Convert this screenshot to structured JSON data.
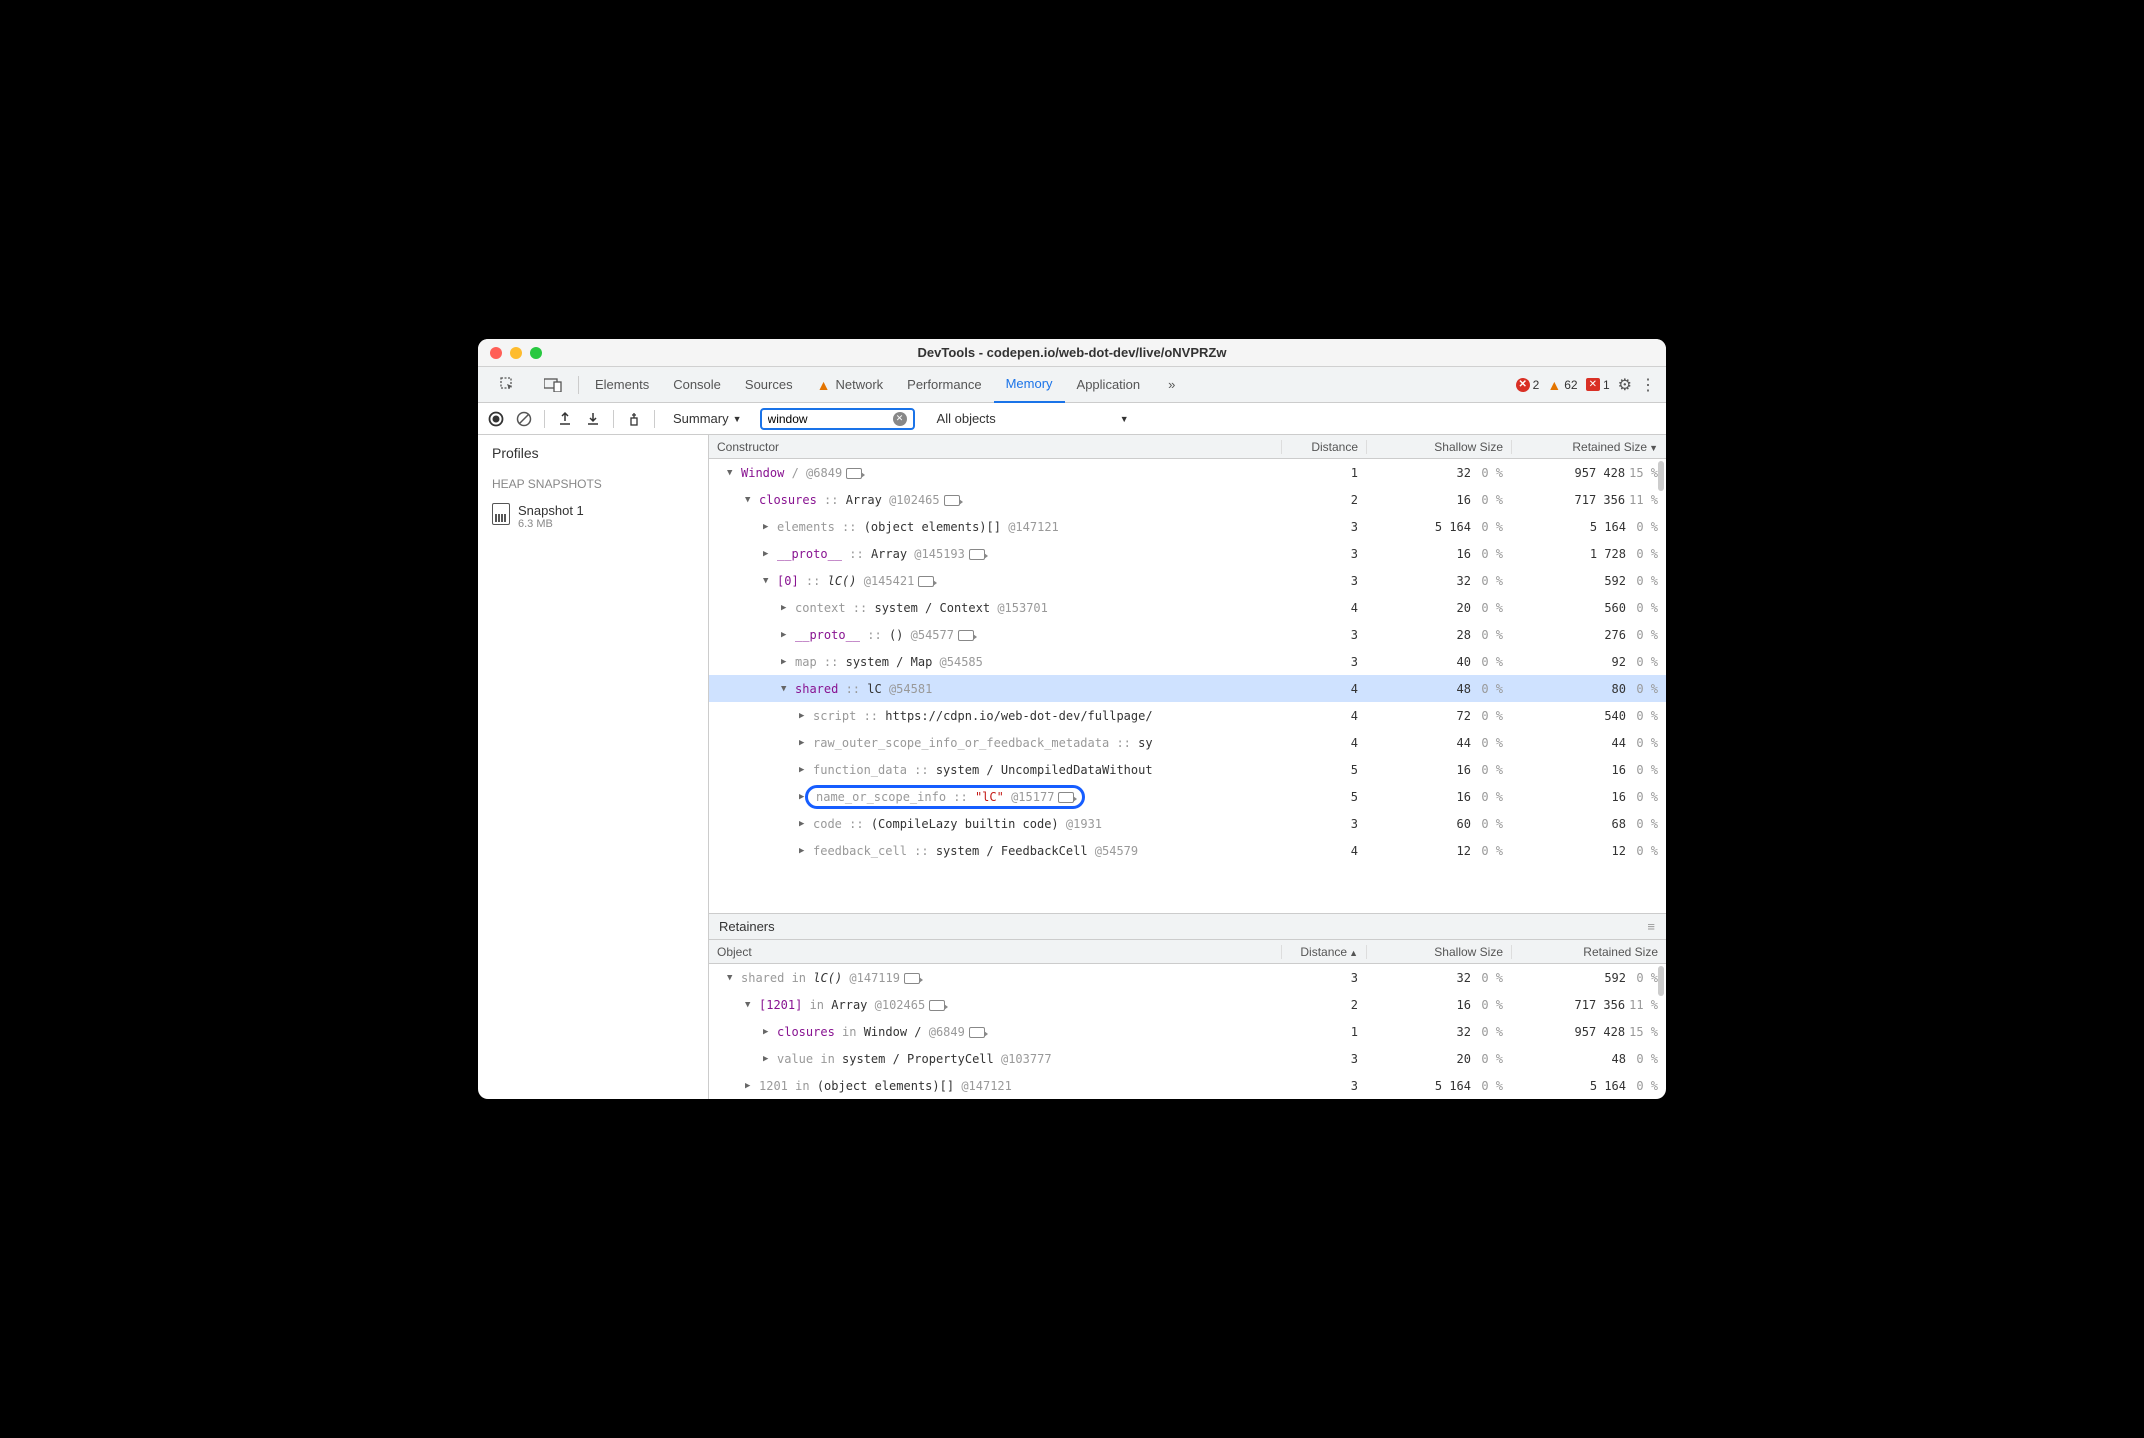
{
  "title": "DevTools - codepen.io/web-dot-dev/live/oNVPRZw",
  "tabs": [
    "Elements",
    "Console",
    "Sources",
    "Network",
    "Performance",
    "Memory",
    "Application"
  ],
  "active_tab": "Memory",
  "warn_tab": "Network",
  "overflow": "»",
  "errors": {
    "error": "2",
    "warn": "62",
    "blocked": "1"
  },
  "toolbar": {
    "view": "Summary",
    "filter_value": "window",
    "scope": "All objects"
  },
  "sidebar": {
    "heading": "Profiles",
    "section": "HEAP SNAPSHOTS",
    "snapshot": {
      "name": "Snapshot 1",
      "size": "6.3 MB"
    }
  },
  "columns": {
    "c": "Constructor",
    "d": "Distance",
    "s": "Shallow Size",
    "r": "Retained Size"
  },
  "retainers_columns": {
    "c": "Object",
    "d": "Distance",
    "s": "Shallow Size",
    "r": "Retained Size"
  },
  "retainers_label": "Retainers",
  "rows": [
    {
      "i": 0,
      "a": "▼",
      "pre": "",
      "prop": "Window",
      "mid": " /   ",
      "id": "@6849",
      "link": 1,
      "d": "1",
      "sv": "32",
      "sp": "0 %",
      "rv": "957 428",
      "rp": "15 %"
    },
    {
      "i": 1,
      "a": "▼",
      "prop": "closures",
      "sep": " :: ",
      "sys": "Array ",
      "id": "@102465",
      "link": 1,
      "d": "2",
      "sv": "16",
      "sp": "0 %",
      "rv": "717 356",
      "rp": "11 %"
    },
    {
      "i": 2,
      "a": "▶",
      "dim": "elements",
      "sep": " :: ",
      "sys": "(object elements)[] ",
      "id": "@147121",
      "d": "3",
      "sv": "5 164",
      "sp": "0 %",
      "rv": "5 164",
      "rp": "0 %"
    },
    {
      "i": 2,
      "a": "▶",
      "prop": "__proto__",
      "sep": " :: ",
      "sys": "Array ",
      "id": "@145193",
      "link": 1,
      "d": "3",
      "sv": "16",
      "sp": "0 %",
      "rv": "1 728",
      "rp": "0 %"
    },
    {
      "i": 2,
      "a": "▼",
      "prop": "[0]",
      "sep": " :: ",
      "ital": "lC()",
      "id": " @145421",
      "link": 1,
      "d": "3",
      "sv": "32",
      "sp": "0 %",
      "rv": "592",
      "rp": "0 %"
    },
    {
      "i": 3,
      "a": "▶",
      "dim": "context",
      "sep": " :: ",
      "sys": "system / Context ",
      "id": "@153701",
      "d": "4",
      "sv": "20",
      "sp": "0 %",
      "rv": "560",
      "rp": "0 %"
    },
    {
      "i": 3,
      "a": "▶",
      "prop": "__proto__",
      "sep": " :: ",
      "sys": "() ",
      "id": "@54577",
      "link": 1,
      "d": "3",
      "sv": "28",
      "sp": "0 %",
      "rv": "276",
      "rp": "0 %"
    },
    {
      "i": 3,
      "a": "▶",
      "dim": "map",
      "sep": " :: ",
      "sys": "system / Map ",
      "id": "@54585",
      "d": "3",
      "sv": "40",
      "sp": "0 %",
      "rv": "92",
      "rp": "0 %"
    },
    {
      "i": 3,
      "a": "▼",
      "prop": "shared",
      "sep": " :: ",
      "sys": "lC ",
      "id": "@54581",
      "d": "4",
      "sv": "48",
      "sp": "0 %",
      "rv": "80",
      "rp": "0 %",
      "sel": 1
    },
    {
      "i": 4,
      "a": "▶",
      "dim": "script",
      "sep": " :: ",
      "sys": "https://cdpn.io/web-dot-dev/fullpage/",
      "d": "4",
      "sv": "72",
      "sp": "0 %",
      "rv": "540",
      "rp": "0 %"
    },
    {
      "i": 4,
      "a": "▶",
      "dim": "raw_outer_scope_info_or_feedback_metadata",
      "sep": " :: ",
      "sys": "sy",
      "d": "4",
      "sv": "44",
      "sp": "0 %",
      "rv": "44",
      "rp": "0 %"
    },
    {
      "i": 4,
      "a": "▶",
      "dim": "function_data",
      "sep": " :: ",
      "sys": "system / UncompiledDataWithout",
      "d": "5",
      "sv": "16",
      "sp": "0 %",
      "rv": "16",
      "rp": "0 %"
    },
    {
      "i": 4,
      "a": "▶",
      "dim": "name_or_scope_info",
      "sep": " :: ",
      "str": "\"lC\"",
      "id": " @15177",
      "link": 1,
      "d": "5",
      "sv": "16",
      "sp": "0 %",
      "rv": "16",
      "rp": "0 %",
      "circ": 1
    },
    {
      "i": 4,
      "a": "▶",
      "dim": "code",
      "sep": " :: ",
      "sys": "(CompileLazy builtin code) ",
      "id": "@1931",
      "d": "3",
      "sv": "60",
      "sp": "0 %",
      "rv": "68",
      "rp": "0 %"
    },
    {
      "i": 4,
      "a": "▶",
      "dim": "feedback_cell",
      "sep": " :: ",
      "sys": "system / FeedbackCell ",
      "id": "@54579",
      "d": "4",
      "sv": "12",
      "sp": "0 %",
      "rv": "12",
      "rp": "0 %"
    }
  ],
  "retain_rows": [
    {
      "i": 0,
      "a": "▼",
      "dim": "shared",
      "mid": " in ",
      "ital": "lC()",
      "id": " @147119",
      "link": 1,
      "d": "3",
      "sv": "32",
      "sp": "0 %",
      "rv": "592",
      "rp": "0 %"
    },
    {
      "i": 1,
      "a": "▼",
      "prop": "[1201]",
      "mid": " in ",
      "sys": "Array ",
      "id": "@102465",
      "link": 1,
      "d": "2",
      "sv": "16",
      "sp": "0 %",
      "rv": "717 356",
      "rp": "11 %"
    },
    {
      "i": 2,
      "a": "▶",
      "prop": "closures",
      "mid": " in ",
      "sys": "Window /   ",
      "id": "@6849",
      "link": 1,
      "d": "1",
      "sv": "32",
      "sp": "0 %",
      "rv": "957 428",
      "rp": "15 %"
    },
    {
      "i": 2,
      "a": "▶",
      "dim": "value",
      "mid": " in ",
      "sys": "system / PropertyCell ",
      "id": "@103777",
      "d": "3",
      "sv": "20",
      "sp": "0 %",
      "rv": "48",
      "rp": "0 %"
    },
    {
      "i": 1,
      "a": "▶",
      "dim": "1201",
      "mid": " in ",
      "sys": "(object elements)[] ",
      "id": "@147121",
      "d": "3",
      "sv": "5 164",
      "sp": "0 %",
      "rv": "5 164",
      "rp": "0 %"
    }
  ]
}
